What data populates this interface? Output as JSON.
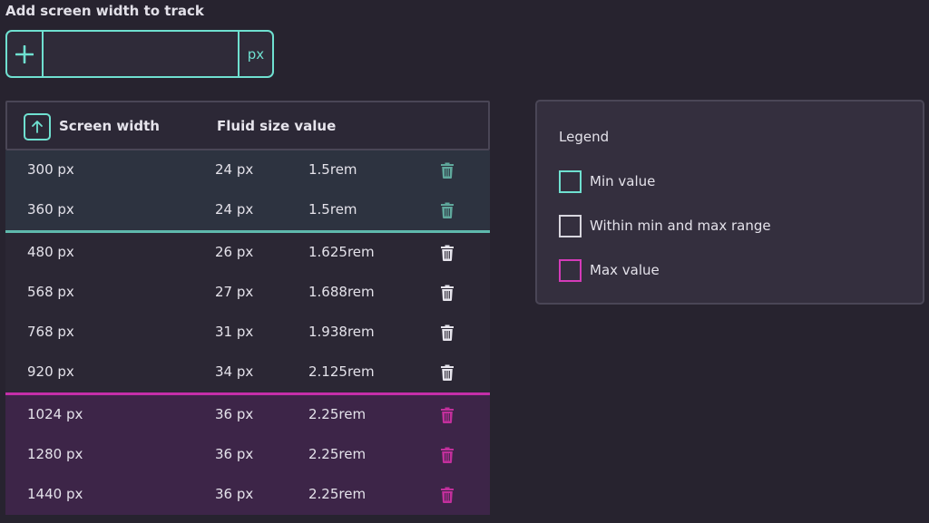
{
  "add": {
    "label": "Add screen width to track",
    "input_value": "",
    "unit": "px",
    "button_icon": "plus-icon"
  },
  "table": {
    "headers": {
      "screen_width": "Screen width",
      "fluid_size": "Fluid size value",
      "sort_icon": "arrow-up-icon"
    },
    "min_rows": [
      {
        "width": "300 px",
        "px": "24 px",
        "rem": "1.5rem"
      },
      {
        "width": "360 px",
        "px": "24 px",
        "rem": "1.5rem"
      }
    ],
    "mid_rows": [
      {
        "width": "480 px",
        "px": "26 px",
        "rem": "1.625rem"
      },
      {
        "width": "568 px",
        "px": "27 px",
        "rem": "1.688rem"
      },
      {
        "width": "768 px",
        "px": "31 px",
        "rem": "1.938rem"
      },
      {
        "width": "920 px",
        "px": "34 px",
        "rem": "2.125rem"
      }
    ],
    "max_rows": [
      {
        "width": "1024 px",
        "px": "36 px",
        "rem": "2.25rem"
      },
      {
        "width": "1280 px",
        "px": "36 px",
        "rem": "2.25rem"
      },
      {
        "width": "1440 px",
        "px": "36 px",
        "rem": "2.25rem"
      }
    ],
    "delete_icon": "trash-icon"
  },
  "legend": {
    "title": "Legend",
    "items": [
      {
        "label": "Min value",
        "color": "#6fe0d0"
      },
      {
        "label": "Within min and max range",
        "color": "#d8d6de"
      },
      {
        "label": "Max value",
        "color": "#d43bb8"
      }
    ]
  },
  "colors": {
    "accent": "#6fe0d0",
    "max": "#d43bb8",
    "min_icon": "#5fa89c",
    "mid_icon": "#e6e4ec",
    "max_icon": "#c22f9c",
    "background": "#27232f"
  }
}
